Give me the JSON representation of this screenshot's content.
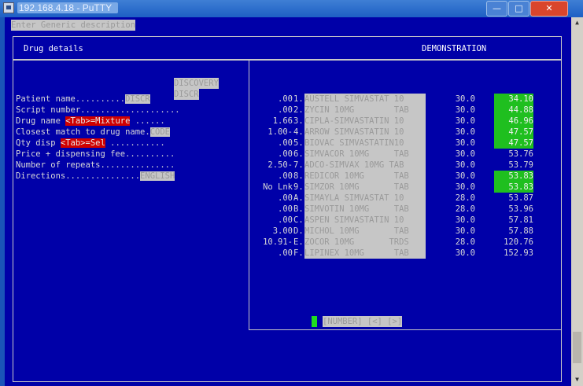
{
  "window": {
    "title": "192.168.4.18 - PuTTY",
    "minimize": "—",
    "maximize": "□",
    "close": "✕"
  },
  "terminal": {
    "top_prompt": "Enter Generic description",
    "header_left": "Drug details",
    "header_right": "DEMONSTRATION",
    "discovery_label": "DISCOVERY",
    "discovery_sub": "DISCR",
    "fields": [
      {
        "label": "Patient name..........",
        "value": "DISCR"
      },
      {
        "label": "Script number....................",
        "value": ""
      },
      {
        "label": "Drug name",
        "tag": "<Tab>=Mixture",
        "dots": "......"
      },
      {
        "label": "Closest match to drug name.",
        "value": "CODE"
      },
      {
        "label": "Qty disp",
        "tag": "<Tab>=Sel",
        "dots": "..........."
      },
      {
        "label": "Price + dispensing fee..........",
        "value": ""
      },
      {
        "label": "Number of repeats...............",
        "value": ""
      },
      {
        "label": "Directions...............",
        "value": "ENGLISH"
      }
    ],
    "drug_rows": [
      {
        "pre": ".00",
        "key": "1.",
        "name": "AUSTELL SIMVASTAT 10",
        "qty": "30.0",
        "price": "34.10",
        "highlight": true
      },
      {
        "pre": ".00",
        "key": "2.",
        "name": "ZYCIN 10MG        TAB",
        "qty": "30.0",
        "price": "44.88",
        "highlight": true
      },
      {
        "pre": "1.66",
        "key": "3.",
        "name": "CIPLA-SIMVASTATIN 10",
        "qty": "30.0",
        "price": "46.96",
        "highlight": true
      },
      {
        "pre": "1.00-",
        "key": "4.",
        "name": "ARROW SIMVASTATIN 10",
        "qty": "30.0",
        "price": "47.57",
        "highlight": true
      },
      {
        "pre": ".00",
        "key": "5.",
        "name": "BIOVAC SIMVASTATIN10",
        "qty": "30.0",
        "price": "47.57",
        "highlight": true
      },
      {
        "pre": ".00",
        "key": "6.",
        "name": "SIMVACOR 10MG     TAB",
        "qty": "30.0",
        "price": "53.76",
        "highlight": false
      },
      {
        "pre": "2.50-",
        "key": "7.",
        "name": "ADCO-SIMVAX 10MG TAB",
        "qty": "30.0",
        "price": "53.79",
        "highlight": false
      },
      {
        "pre": ".00",
        "key": "8.",
        "name": "REDICOR 10MG      TAB",
        "qty": "30.0",
        "price": "53.83",
        "highlight": true
      },
      {
        "pre": "No Lnk",
        "key": "9.",
        "name": "SIMZOR 10MG       TAB",
        "qty": "30.0",
        "price": "53.83",
        "highlight": true
      },
      {
        "pre": ".00",
        "key": "A.",
        "name": "SIMAYLA SIMVASTAT 10",
        "qty": "28.0",
        "price": "53.87",
        "highlight": false
      },
      {
        "pre": ".00",
        "key": "B.",
        "name": "SIMVOTIN 10MG     TAB",
        "qty": "28.0",
        "price": "53.96",
        "highlight": false
      },
      {
        "pre": ".00",
        "key": "C.",
        "name": "ASPEN SIMVASTATIN 10",
        "qty": "30.0",
        "price": "57.81",
        "highlight": false
      },
      {
        "pre": "3.00",
        "key": "D.",
        "name": "MICHOL 10MG       TAB",
        "qty": "30.0",
        "price": "57.88",
        "highlight": false
      },
      {
        "pre": "10.91-",
        "key": "E.",
        "name": "ZOCOR 10MG       TRDS",
        "qty": "28.0",
        "price": "120.76",
        "highlight": false
      },
      {
        "pre": ".00",
        "key": "F.",
        "name": "LIPINEX 10MG      TAB",
        "qty": "30.0",
        "price": "152.93",
        "highlight": false
      }
    ],
    "footer_bar": "[NUMBER] [<] [>]"
  }
}
